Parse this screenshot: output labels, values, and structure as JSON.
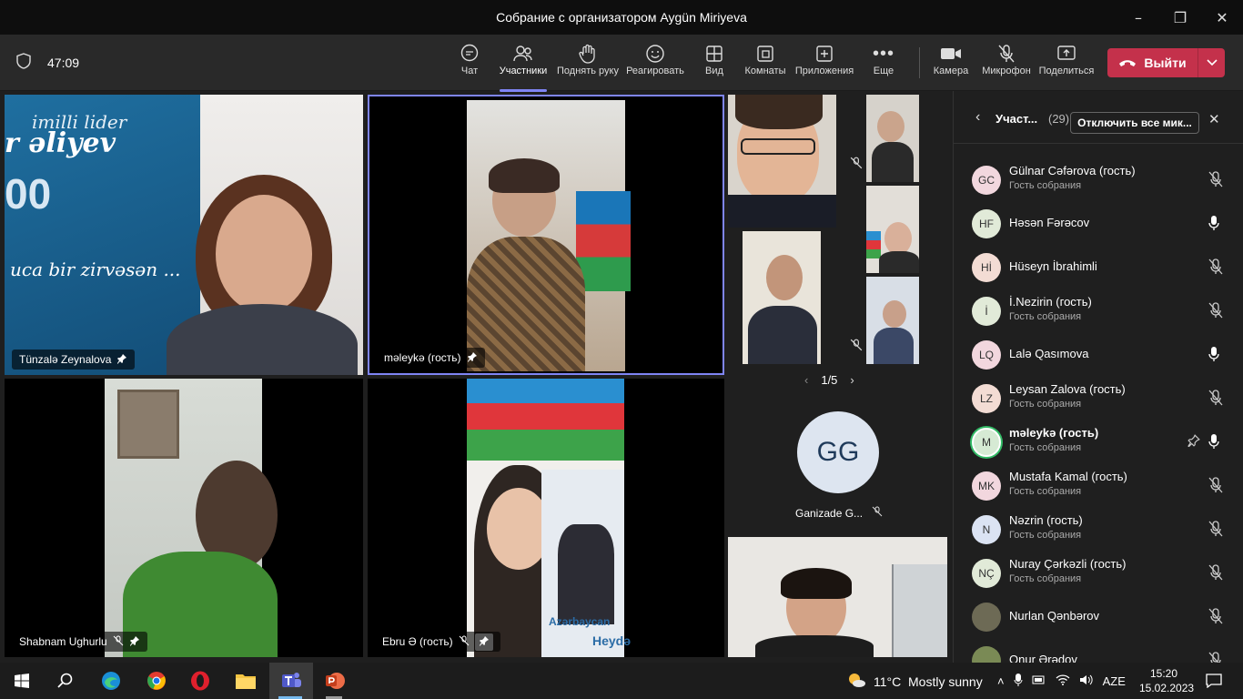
{
  "window": {
    "title": "Собрание с организатором Aygün Miriyeva"
  },
  "toolbar": {
    "timer": "47:09",
    "chat": "Чат",
    "participants": "Участники",
    "raise_hand": "Поднять руку",
    "react": "Реагировать",
    "view": "Вид",
    "rooms": "Комнаты",
    "apps": "Приложения",
    "more": "Еще",
    "camera": "Камера",
    "mic": "Микрофон",
    "share": "Поделиться",
    "leave": "Выйти"
  },
  "videos": {
    "v1": {
      "name": "Tünzalə Zeynalova",
      "bg_text1": "imilli lider",
      "bg_text2": "r əliyev",
      "bg_text3": "00",
      "bg_text4": "uca bir zirvəsən ..."
    },
    "v2": {
      "name": "məleykə (гость)"
    },
    "v3": {
      "name": "Shabnam Ughurlu"
    },
    "v4": {
      "name": "Ebru Ə (гость)",
      "poster1": "Azərbaycan",
      "poster2": "Heydə"
    },
    "pager": "1/5",
    "gg": {
      "initials": "GG",
      "name": "Ganizade G..."
    }
  },
  "panel": {
    "title": "Участ...",
    "count": "(29)",
    "mute_all": "Отключить все мик...",
    "participants": [
      {
        "initials": "GC",
        "name": "Gülnar Cəfərova (гость)",
        "sub": "Гость собрания",
        "muted": true,
        "color": "#f2d7de"
      },
      {
        "initials": "HF",
        "name": "Həsən Fərəcov",
        "sub": "",
        "muted": false,
        "color": "#e1ead8"
      },
      {
        "initials": "Hİ",
        "name": "Hüseyn İbrahimli",
        "sub": "",
        "muted": true,
        "color": "#f3dcd4"
      },
      {
        "initials": "İ",
        "name": "İ.Nezirin (гость)",
        "sub": "Гость собрания",
        "muted": true,
        "color": "#e1ead8"
      },
      {
        "initials": "LQ",
        "name": "Lalə Qasımova",
        "sub": "",
        "muted": false,
        "color": "#f2d7de"
      },
      {
        "initials": "LZ",
        "name": "Leysan Zalova (гость)",
        "sub": "Гость собрания",
        "muted": true,
        "color": "#f3dcd4"
      },
      {
        "initials": "M",
        "name": "məleykə (гость)",
        "sub": "Гость собрания",
        "muted": false,
        "color": "#d6ead4"
      },
      {
        "initials": "MK",
        "name": "Mustafa Kamal (гость)",
        "sub": "Гость собрания",
        "muted": true,
        "color": "#f2d7de"
      },
      {
        "initials": "N",
        "name": "Nəzrin (гость)",
        "sub": "Гость собрания",
        "muted": true,
        "color": "#dbe3f3"
      },
      {
        "initials": "NÇ",
        "name": "Nuray Çərkəzli (гость)",
        "sub": "Гость собрания",
        "muted": true,
        "color": "#e1ead8"
      },
      {
        "initials": "",
        "name": "Nurlan Qənbərov",
        "sub": "",
        "muted": true,
        "color": "#6d6a55"
      },
      {
        "initials": "",
        "name": "Onur Ərədov",
        "sub": "",
        "muted": true,
        "color": "#7a8a55"
      }
    ]
  },
  "taskbar": {
    "weather": "11°C  Mostly sunny",
    "lang": "AZE",
    "time": "15:20",
    "date": "15.02.2023"
  }
}
